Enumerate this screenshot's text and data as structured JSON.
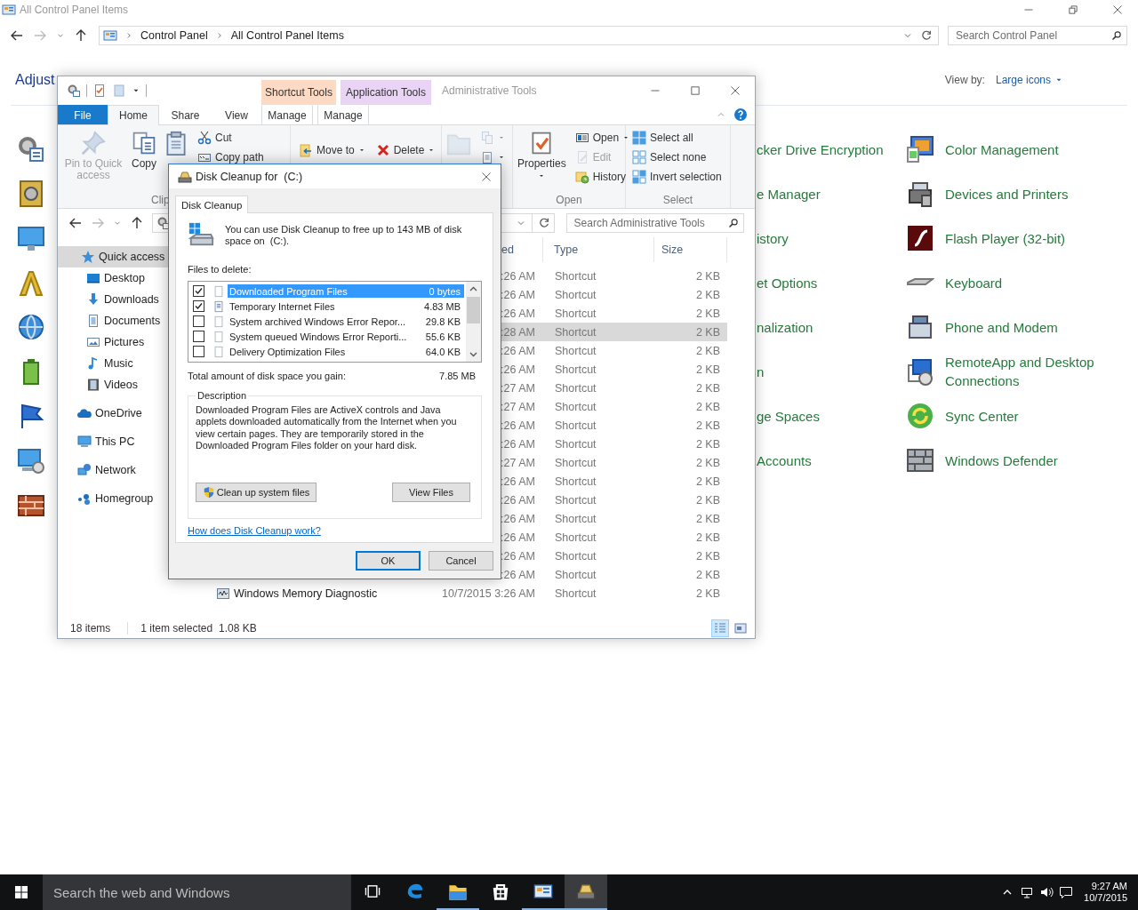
{
  "control_panel": {
    "title": "All Control Panel Items",
    "breadcrumb": [
      "Control Panel",
      "All Control Panel Items"
    ],
    "search": {
      "placeholder": "Search Control Panel"
    },
    "heading": "Adjust",
    "view_by": {
      "label": "View by:",
      "value": "Large icons"
    },
    "items_partial": [
      "cker Drive Encryption",
      "e Manager",
      "istory",
      "et Options",
      "nalization",
      "n",
      "ge Spaces",
      "Accounts"
    ],
    "items": [
      "Color Management",
      "Devices and Printers",
      "Flash Player (32-bit)",
      "Keyboard",
      "Phone and Modem",
      "RemoteApp and Desktop Connections",
      "Sync Center",
      "Windows Defender"
    ]
  },
  "explorer": {
    "title": "Administrative Tools",
    "context_groups": [
      {
        "label": "Shortcut Tools",
        "color": "#fcdac4",
        "tab": {
          "label": "Manage",
          "selected": false
        }
      },
      {
        "label": "Application Tools",
        "color": "#ead4f6",
        "tab": {
          "label": "Manage",
          "selected": false
        }
      }
    ],
    "tabs": [
      {
        "label": "File",
        "kind": "file",
        "selected": false
      },
      {
        "label": "Home",
        "kind": "tab",
        "selected": true
      },
      {
        "label": "Share",
        "kind": "tab",
        "selected": false
      },
      {
        "label": "View",
        "kind": "tab",
        "selected": false
      }
    ],
    "ribbon_groups": [
      {
        "label": "Clip",
        "commands": [
          {
            "kind": "large",
            "label": "Pin to Quick access",
            "disabled": true,
            "dropdown": false
          },
          {
            "kind": "large",
            "label": "Copy",
            "disabled": false,
            "dropdown": false
          },
          {
            "kind": "large",
            "disabled": false,
            "dropdown": false
          },
          {
            "kind": "stack",
            "items": [
              {
                "label": "Cut",
                "disabled": false,
                "dropdown": false
              },
              {
                "label": "Copy path",
                "disabled": false,
                "dropdown": false
              }
            ]
          }
        ]
      },
      {
        "commands": [
          {
            "kind": "stack",
            "items": [
              {
                "label": "Move to",
                "disabled": false,
                "dropdown": true
              }
            ]
          },
          {
            "kind": "stack",
            "items": [
              {
                "label": "Delete",
                "disabled": false,
                "dropdown": true
              }
            ]
          }
        ]
      },
      {
        "commands": [
          {
            "kind": "large",
            "disabled": true,
            "dropdown": false
          },
          {
            "kind": "stack",
            "items": [
              {
                "disabled": true,
                "dropdown": true
              },
              {
                "disabled": false,
                "dropdown": true
              }
            ]
          }
        ]
      },
      {
        "label": "Open",
        "commands": [
          {
            "kind": "large",
            "label": "Properties",
            "disabled": false,
            "dropdown": true
          },
          {
            "kind": "stack",
            "items": [
              {
                "label": "Open",
                "disabled": false,
                "dropdown": true
              },
              {
                "label": "Edit",
                "disabled": true,
                "dropdown": false
              },
              {
                "label": "History",
                "disabled": false,
                "dropdown": false
              }
            ]
          }
        ]
      },
      {
        "label": "Select",
        "commands": [
          {
            "kind": "stack",
            "items": [
              {
                "label": "Select all",
                "disabled": false,
                "dropdown": false
              },
              {
                "label": "Select none",
                "disabled": false,
                "dropdown": false
              },
              {
                "label": "Invert selection",
                "disabled": false,
                "dropdown": false
              }
            ]
          }
        ]
      }
    ],
    "search": {
      "placeholder": "Search Administrative Tools"
    },
    "sidebar": [
      {
        "label": "Quick access",
        "selected": true,
        "children": [
          {
            "label": "Desktop",
            "selected": false
          },
          {
            "label": "Downloads",
            "selected": false
          },
          {
            "label": "Documents",
            "selected": false
          },
          {
            "label": "Pictures",
            "selected": false
          },
          {
            "label": "Music",
            "selected": false
          },
          {
            "label": "Videos",
            "selected": false
          }
        ]
      },
      {
        "label": "OneDrive",
        "selected": false
      },
      {
        "label": "This PC",
        "selected": false
      },
      {
        "label": "Network",
        "selected": false
      },
      {
        "label": "Homegroup",
        "selected": false
      }
    ],
    "columns": [
      "ed",
      "Type",
      "Size"
    ],
    "rows": [
      {
        "date": ":26 AM",
        "type": "Shortcut",
        "size": "2 KB",
        "selected": false
      },
      {
        "date": ":26 AM",
        "type": "Shortcut",
        "size": "2 KB",
        "selected": false
      },
      {
        "date": ":26 AM",
        "type": "Shortcut",
        "size": "2 KB",
        "selected": false
      },
      {
        "date": ":28 AM",
        "type": "Shortcut",
        "size": "2 KB",
        "selected": true
      },
      {
        "date": ":26 AM",
        "type": "Shortcut",
        "size": "2 KB",
        "selected": false
      },
      {
        "date": ":26 AM",
        "type": "Shortcut",
        "size": "2 KB",
        "selected": false
      },
      {
        "date": ":27 AM",
        "type": "Shortcut",
        "size": "2 KB",
        "selected": false
      },
      {
        "date": ":27 AM",
        "type": "Shortcut",
        "size": "2 KB",
        "selected": false
      },
      {
        "date": ":26 AM",
        "type": "Shortcut",
        "size": "2 KB",
        "selected": false
      },
      {
        "date": ":26 AM",
        "type": "Shortcut",
        "size": "2 KB",
        "selected": false
      },
      {
        "date": ":27 AM",
        "type": "Shortcut",
        "size": "2 KB",
        "selected": false
      },
      {
        "date": ":26 AM",
        "type": "Shortcut",
        "size": "2 KB",
        "selected": false
      },
      {
        "date": ":26 AM",
        "type": "Shortcut",
        "size": "2 KB",
        "selected": false
      },
      {
        "date": ":26 AM",
        "type": "Shortcut",
        "size": "2 KB",
        "selected": false
      },
      {
        "date": ":26 AM",
        "type": "Shortcut",
        "size": "2 KB",
        "selected": false
      },
      {
        "date": ":26 AM",
        "type": "Shortcut",
        "size": "2 KB",
        "selected": false
      },
      {
        "date": ":26 AM",
        "type": "Shortcut",
        "size": "2 KB",
        "selected": false
      },
      {
        "name": "Windows Memory Diagnostic",
        "date": "10/7/2015 3:26 AM",
        "type": "Shortcut",
        "size": "2 KB",
        "selected": false
      }
    ],
    "status": {
      "count": "18 items",
      "selection": "1 item selected",
      "selection_size": "1.08 KB"
    },
    "view_modes": [
      {
        "kind": "details",
        "selected": true
      },
      {
        "kind": "large",
        "selected": false
      }
    ]
  },
  "dialog": {
    "title": "Disk Cleanup for  (C:)",
    "tab": "Disk Cleanup",
    "intro": "You can use Disk Cleanup to free up to 143 MB of disk space on  (C:).",
    "files_label": "Files to delete:",
    "files": [
      {
        "name": "Downloaded Program Files",
        "size": "0 bytes",
        "checked": true,
        "selected": true
      },
      {
        "name": "Temporary Internet Files",
        "size": "4.83 MB",
        "checked": true,
        "selected": false
      },
      {
        "name": "System archived Windows Error Repor...",
        "size": "29.8 KB",
        "checked": false,
        "selected": false
      },
      {
        "name": "System queued Windows Error Reporti...",
        "size": "55.6 KB",
        "checked": false,
        "selected": false
      },
      {
        "name": "Delivery Optimization Files",
        "size": "64.0 KB",
        "checked": false,
        "selected": false
      }
    ],
    "total_label": "Total amount of disk space you gain:",
    "total": "7.85 MB",
    "description_label": "Description",
    "description": "Downloaded Program Files are ActiveX controls and Java applets downloaded automatically from the Internet when you view certain pages. They are temporarily stored in the Downloaded Program Files folder on your hard disk.",
    "buttons": [
      "Clean up system files",
      "View Files"
    ],
    "link": "How does Disk Cleanup work?",
    "footer_buttons": [
      {
        "label": "OK",
        "default": true
      },
      {
        "label": "Cancel",
        "default": false
      }
    ]
  },
  "taskbar": {
    "search": {
      "placeholder": "Search the web and Windows"
    },
    "apps": [
      {
        "kind": "taskview",
        "running": false,
        "selected": false
      },
      {
        "kind": "edge",
        "running": false,
        "selected": false
      },
      {
        "kind": "explorer",
        "running": true,
        "selected": false
      },
      {
        "kind": "store",
        "running": false,
        "selected": false
      },
      {
        "kind": "control_panel",
        "running": true,
        "selected": false
      },
      {
        "kind": "cleanup",
        "running": true,
        "selected": true
      }
    ],
    "time": "9:27 AM",
    "date": "10/7/2015"
  }
}
